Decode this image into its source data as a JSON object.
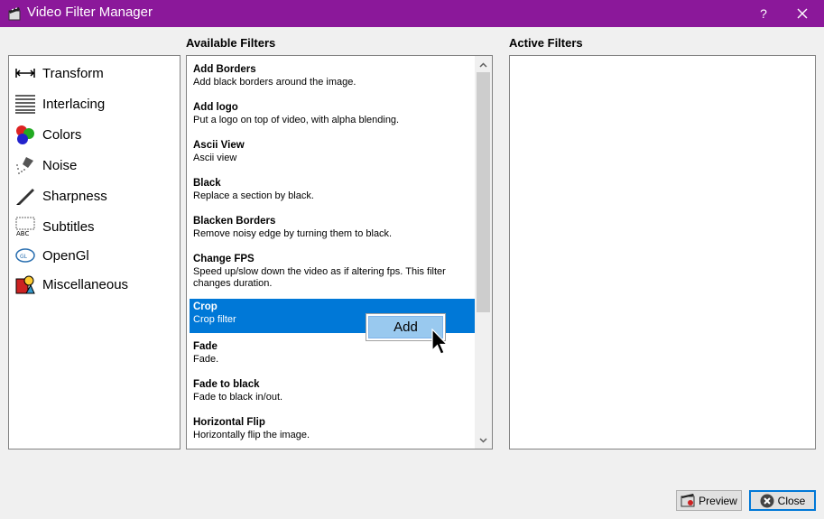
{
  "window": {
    "title": "Video Filter Manager",
    "help_label": "?"
  },
  "headers": {
    "available": "Available Filters",
    "active": "Active Filters"
  },
  "categories": [
    {
      "label": "Transform",
      "icon": "transform-arrows-icon"
    },
    {
      "label": "Interlacing",
      "icon": "interlacing-lines-icon"
    },
    {
      "label": "Colors",
      "icon": "colors-balls-icon"
    },
    {
      "label": "Noise",
      "icon": "noise-brush-icon"
    },
    {
      "label": "Sharpness",
      "icon": "sharpness-pen-icon"
    },
    {
      "label": "Subtitles",
      "icon": "subtitles-icon"
    },
    {
      "label": "OpenGl",
      "icon": "opengl-icon"
    },
    {
      "label": "Miscellaneous",
      "icon": "miscellaneous-shapes-icon"
    }
  ],
  "filters": [
    {
      "name": "Add Borders",
      "desc": "Add black borders around the image."
    },
    {
      "name": "Add logo",
      "desc": "Put a logo on top of video, with alpha blending."
    },
    {
      "name": "Ascii View",
      "desc": "Ascii view"
    },
    {
      "name": "Black",
      "desc": "Replace a section by black."
    },
    {
      "name": "Blacken Borders",
      "desc": "Remove noisy edge by turning them to black."
    },
    {
      "name": "Change FPS",
      "desc": "Speed up/slow down the video as if altering fps. This filter changes duration."
    },
    {
      "name": "Crop",
      "desc": "Crop filter",
      "selected": true
    },
    {
      "name": "Fade",
      "desc": "Fade."
    },
    {
      "name": "Fade to black",
      "desc": "Fade to black in/out."
    },
    {
      "name": "Horizontal Flip",
      "desc": "Horizontally flip the image."
    }
  ],
  "context_menu": {
    "add_label": "Add"
  },
  "buttons": {
    "preview": "Preview",
    "close": "Close"
  },
  "colors": {
    "titlebar": "#8b189a",
    "selection": "#0078d7",
    "focus_border": "#0078d7"
  }
}
